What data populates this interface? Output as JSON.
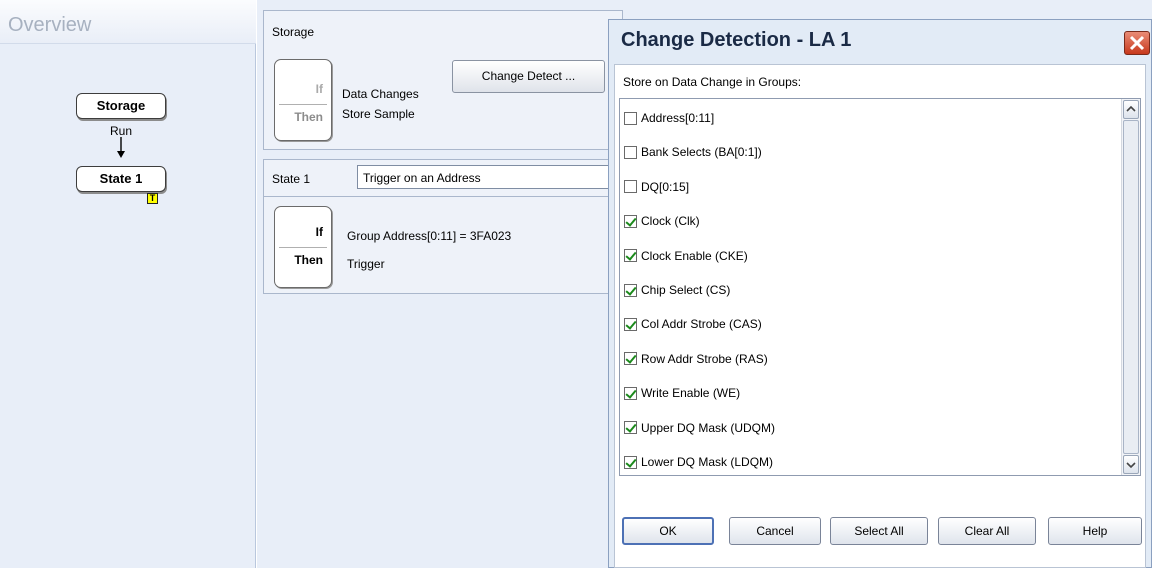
{
  "overview": {
    "title": "Overview",
    "nodes": {
      "storage": "Storage",
      "run": "Run",
      "state1": "State 1",
      "trigger_marker": "T"
    }
  },
  "storage_panel": {
    "label": "Storage",
    "if_label": "If",
    "then_label": "Then",
    "condition": "Data Changes",
    "action": "Store Sample",
    "change_detect_button": "Change Detect ..."
  },
  "state_panel": {
    "label": "State 1",
    "dropdown_value": "Trigger on an Address",
    "if_label": "If",
    "then_label": "Then",
    "condition": "Group Address[0:11] = 3FA023",
    "action": "Trigger"
  },
  "dialog": {
    "title": "Change Detection - LA 1",
    "prompt": "Store on Data Change in Groups:",
    "groups": [
      {
        "label": "Address[0:11]",
        "checked": false
      },
      {
        "label": "Bank Selects (BA[0:1])",
        "checked": false
      },
      {
        "label": "DQ[0:15]",
        "checked": false
      },
      {
        "label": "Clock (Clk)",
        "checked": true
      },
      {
        "label": "Clock Enable (CKE)",
        "checked": true
      },
      {
        "label": "Chip Select (CS)",
        "checked": true
      },
      {
        "label": "Col Addr Strobe (CAS)",
        "checked": true
      },
      {
        "label": "Row Addr Strobe (RAS)",
        "checked": true
      },
      {
        "label": "Write Enable (WE)",
        "checked": true
      },
      {
        "label": "Upper DQ Mask (UDQM)",
        "checked": true
      },
      {
        "label": "Lower DQ Mask (LDQM)",
        "checked": true
      }
    ],
    "buttons": {
      "ok": "OK",
      "cancel": "Cancel",
      "select_all": "Select All",
      "clear_all": "Clear All",
      "help": "Help"
    }
  },
  "colors": {
    "panel_bg": "#e8eef8",
    "close_button": "#c7381c",
    "check_mark": "#1c8a1c",
    "trigger_marker": "#ffff00"
  }
}
